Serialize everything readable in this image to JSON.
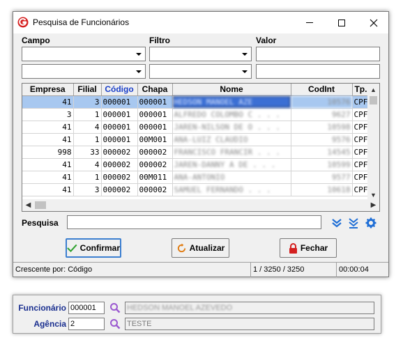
{
  "window": {
    "title": "Pesquisa de Funcionários",
    "filters": {
      "campo_label": "Campo",
      "filtro_label": "Filtro",
      "valor_label": "Valor",
      "row1": {
        "campo": "",
        "filtro": "",
        "valor": ""
      },
      "row2": {
        "campo": "",
        "filtro": "",
        "valor": ""
      }
    },
    "grid": {
      "columns": [
        "Empresa",
        "Filial",
        "Código",
        "Chapa",
        "Nome",
        "CodInt",
        "Tp."
      ],
      "sorted_column": "Código",
      "rows": [
        {
          "empresa": "41",
          "filial": "3",
          "codigo": "000001",
          "chapa": "000001",
          "nome": "HEDSON MANOEL AZE",
          "codint": "10576",
          "tp": "CPF"
        },
        {
          "empresa": "3",
          "filial": "1",
          "codigo": "000001",
          "chapa": "000001",
          "nome": "ALFREDO COLOMBO C . . .",
          "codint": "9627",
          "tp": "CPF"
        },
        {
          "empresa": "41",
          "filial": "4",
          "codigo": "000001",
          "chapa": "000001",
          "nome": "JAREN-NILSON DE O . . .",
          "codint": "10598",
          "tp": "CPF"
        },
        {
          "empresa": "41",
          "filial": "1",
          "codigo": "000001",
          "chapa": "00M001",
          "nome": "ANA-LUIZ CLAUDIO",
          "codint": "9576",
          "tp": "CPF"
        },
        {
          "empresa": "998",
          "filial": "33",
          "codigo": "000002",
          "chapa": "000002",
          "nome": "FRANCISCO FRANCIR . . .",
          "codint": "14545",
          "tp": "CPF"
        },
        {
          "empresa": "41",
          "filial": "4",
          "codigo": "000002",
          "chapa": "000002",
          "nome": "JAREN-DANNY A  DE . . .",
          "codint": "10599",
          "tp": "CPF"
        },
        {
          "empresa": "41",
          "filial": "1",
          "codigo": "000002",
          "chapa": "00M011",
          "nome": "ANA-ANTONIO",
          "codint": "9577",
          "tp": "CPF"
        },
        {
          "empresa": "41",
          "filial": "3",
          "codigo": "000002",
          "chapa": "000002",
          "nome": "SAMUEL FERNANDO . . .",
          "codint": "10618",
          "tp": "CPF"
        }
      ]
    },
    "search": {
      "label": "Pesquisa",
      "value": ""
    },
    "buttons": {
      "confirm": "Confirmar",
      "refresh": "Atualizar",
      "close": "Fechar"
    },
    "status": {
      "sort": "Crescente por: Código",
      "count": "1 / 3250 / 3250",
      "time": "00:00:04"
    },
    "icons": [
      "app-logo-icon",
      "minimize-icon",
      "maximize-icon",
      "close-icon",
      "double-chevron-down-icon",
      "chevron-to-bottom-icon",
      "gear-icon",
      "checkmark-icon",
      "refresh-icon",
      "lock-icon"
    ]
  },
  "bottom_panel": {
    "funcionario_label": "Funcionário",
    "funcionario_code": "000001",
    "funcionario_name": "HEDSON MANOEL AZEVEDO",
    "agencia_label": "Agência",
    "agencia_code": "2",
    "agencia_name": "TESTE"
  },
  "colors": {
    "accent_blue": "#1e6ed6",
    "selected_row": "#a8c8f0",
    "focus_cell": "#3b6fd4",
    "lock_red": "#d42020",
    "check_green": "#2ca02c",
    "refresh_orange": "#e07b10"
  }
}
